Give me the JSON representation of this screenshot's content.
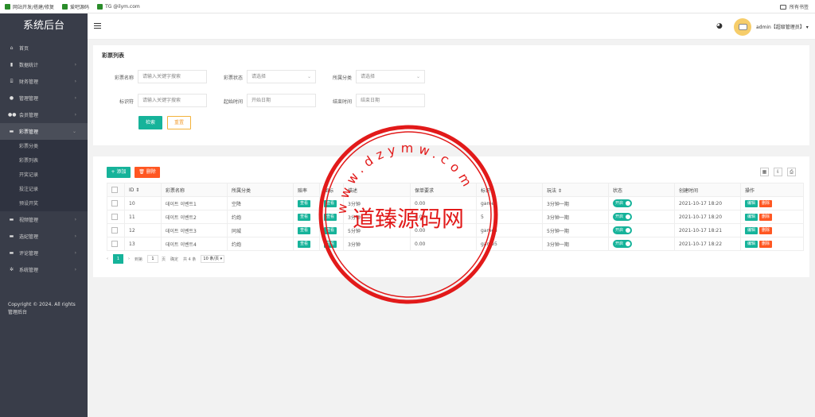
{
  "bookmarks": {
    "items": [
      "网站开发/搭建/修复",
      "爱吧源码",
      "TG @ilym.com"
    ],
    "folder": "所有书签"
  },
  "sidebar": {
    "title": "系统后台",
    "items": [
      {
        "label": "首页",
        "icon": "home-icon",
        "arrow": ""
      },
      {
        "label": "数据统计",
        "icon": "chart-icon",
        "arrow": "›"
      },
      {
        "label": "财务管理",
        "icon": "bank-icon",
        "arrow": "›"
      },
      {
        "label": "管理管理",
        "icon": "user-icon",
        "arrow": "›"
      },
      {
        "label": "会员管理",
        "icon": "users-icon",
        "arrow": "›"
      },
      {
        "label": "彩票管理",
        "icon": "gamepad-icon",
        "arrow": "⌄"
      }
    ],
    "sub": [
      "彩票分类",
      "彩票列表",
      "开奖记录",
      "投注记录",
      "预设开奖"
    ],
    "items2": [
      {
        "label": "视频管理",
        "icon": "video-icon",
        "arrow": "›"
      },
      {
        "label": "选妃管理",
        "icon": "heart-icon",
        "arrow": "›"
      },
      {
        "label": "评论管理",
        "icon": "comment-icon",
        "arrow": "›"
      },
      {
        "label": "系统管理",
        "icon": "gear-icon",
        "arrow": "›"
      }
    ],
    "copyright": "Copyright © 2024. All rights 管理后台"
  },
  "header": {
    "user": "admin【超级管理员】 ▾"
  },
  "filter": {
    "title": "彩票列表",
    "name_label": "彩票名称",
    "name_placeholder": "请输入关键字搜索",
    "status_label": "彩票状态",
    "status_value": "请选择",
    "category_label": "所属分类",
    "category_value": "请选择",
    "mark_label": "标识符",
    "mark_placeholder": "请输入关键字搜索",
    "start_label": "起始时间",
    "start_placeholder": "开始日期",
    "end_label": "结束时间",
    "end_placeholder": "结束日期",
    "search_btn": "检索",
    "reset_btn": "重置"
  },
  "table": {
    "add_btn": "+ 添加",
    "del_btn": "🗑 删除",
    "headers": [
      "",
      "ID ⇕",
      "彩票名称",
      "所属分类",
      "赔率",
      "图标",
      "描述",
      "保单要求",
      "标识",
      "玩法 ⇕",
      "状态",
      "创建时间",
      "操作"
    ],
    "rows": [
      {
        "id": "10",
        "name": "데이트 이벤트1",
        "cat": "空降",
        "odds": "查看",
        "icon": "查看",
        "desc": "3分钟",
        "req": "0.00",
        "mark": "game1",
        "play": "3分钟一期",
        "status": "开启",
        "time": "2021-10-17 18:20"
      },
      {
        "id": "11",
        "name": "데이트 이벤트2",
        "cat": "约炮",
        "odds": "查看",
        "icon": "查看",
        "desc": "3分钟",
        "req": "0.00",
        "mark": "5",
        "play": "3分钟一期",
        "status": "开启",
        "time": "2021-10-17 18:20"
      },
      {
        "id": "12",
        "name": "데이트 이벤트3",
        "cat": "同城",
        "odds": "查看",
        "icon": "查看",
        "desc": "5分钟",
        "req": "0.00",
        "mark": "game3",
        "play": "5分钟一期",
        "status": "开启",
        "time": "2021-10-17 18:21"
      },
      {
        "id": "13",
        "name": "데이트 이벤트4",
        "cat": "约炮",
        "odds": "查看",
        "icon": "查看",
        "desc": "3分钟",
        "req": "0.00",
        "mark": "game5",
        "play": "3分钟一期",
        "status": "开启",
        "time": "2021-10-17 18:22"
      }
    ],
    "edit": "编辑",
    "delete": "删除"
  },
  "pager": {
    "prev": "‹",
    "page": "1",
    "next": "›",
    "goto": "到第",
    "input": "1",
    "unit": "页",
    "confirm": "确定",
    "total": "共 4 条",
    "size": "10 条/页 ▾"
  },
  "watermark": {
    "text": "道臻源码网",
    "ring": "www.dzymw.com"
  }
}
